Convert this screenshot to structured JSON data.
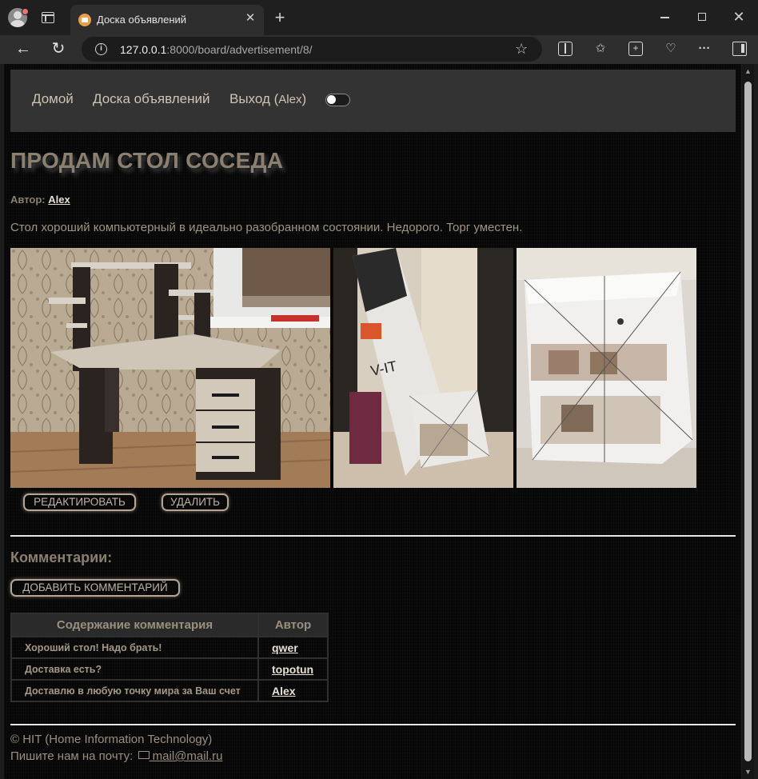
{
  "browser": {
    "tab_title": "Доска объявлений",
    "url_host": "127.0.0.1",
    "url_rest": ":8000/board/advertisement/8/"
  },
  "nav": {
    "home": "Домой",
    "board": "Доска объявлений",
    "logout": "Выход (",
    "user": "Alex",
    "logout_close": ")"
  },
  "ad": {
    "title": "ПРОДАМ СТОЛ СОСЕДА",
    "author_label": "Автор:",
    "author": "Alex",
    "text": "Стол хороший компьютерный в идеально разобранном состоянии. Недорого. Торг уместен.",
    "edit_button": "РЕДАКТИРОВАТЬ",
    "delete_button": "УДАЛИТЬ"
  },
  "comments": {
    "title": "Комментарии:",
    "add_button": "ДОБАВИТЬ КОММЕНТАРИЙ",
    "columns": [
      "Содержание комментария",
      "Автор"
    ],
    "rows": [
      {
        "text": "Хороший стол! Надо брать!",
        "author": "qwer"
      },
      {
        "text": "Доставка есть?",
        "author": "topotun"
      },
      {
        "text": "Доставлю в любую точку мира за Ваш счет",
        "author": "Alex"
      }
    ]
  },
  "footer": {
    "copyright": "© HIT (Home Information Technology)",
    "mail_label": "Пишите нам на почту:",
    "mail": " mail@mail.ru"
  },
  "colors": {
    "accent_text": "#8b7f70",
    "page_bg": "#070707",
    "nav_bg": "#333333"
  }
}
